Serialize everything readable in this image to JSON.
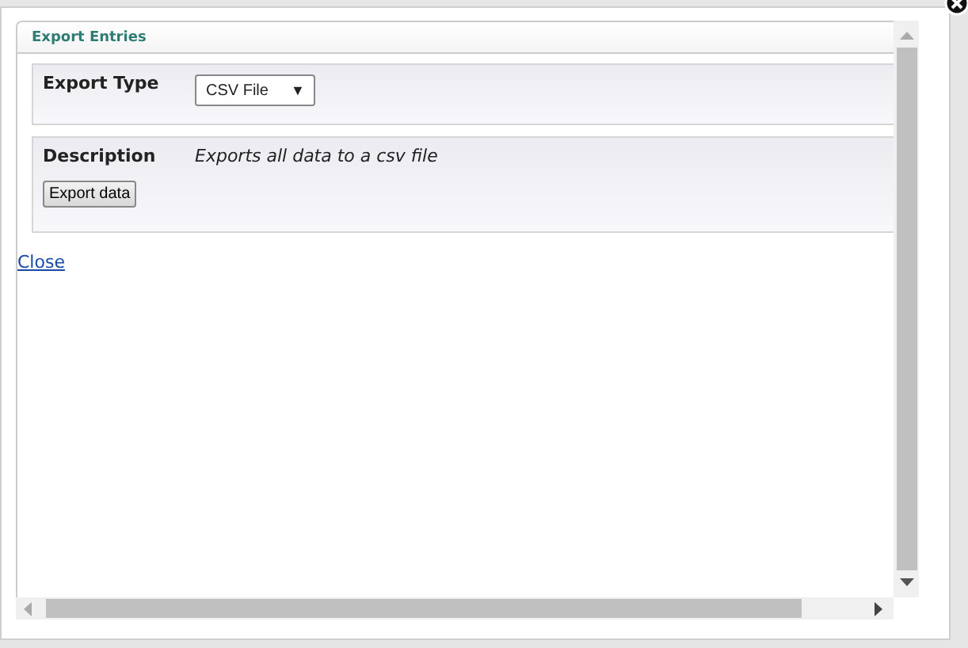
{
  "dialog": {
    "title": "Export Entries"
  },
  "form": {
    "export_type_label": "Export Type",
    "export_type_value": "CSV File",
    "dropdown_caret": "▼",
    "description_label": "Description",
    "description_text": "Exports all data to a csv file",
    "export_button": "Export data"
  },
  "close_link": "Close"
}
